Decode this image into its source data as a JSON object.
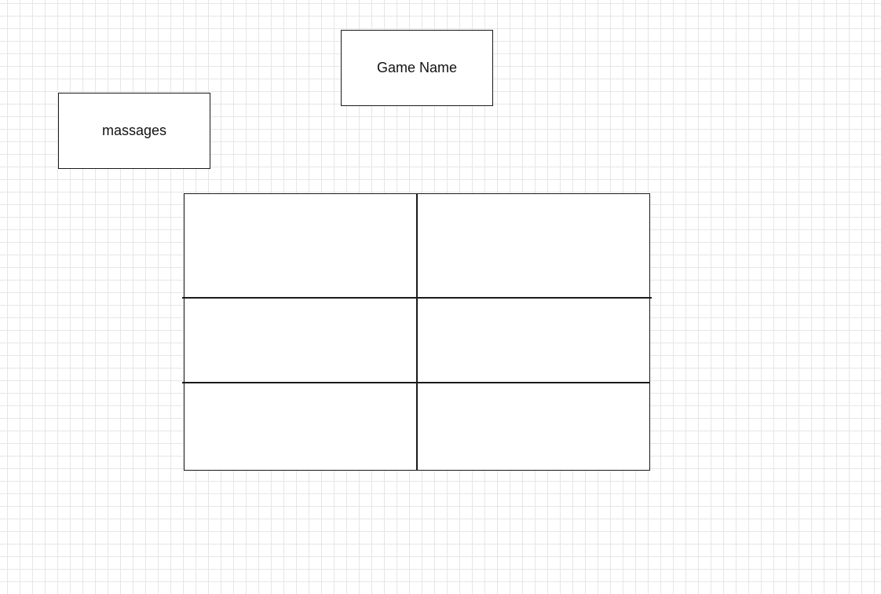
{
  "diagram": {
    "title_box": {
      "label": "Game Name"
    },
    "messages_box": {
      "label": "massages"
    },
    "board": {
      "rows": 3,
      "columns": 2,
      "cells": [
        "",
        "",
        "",
        "",
        "",
        ""
      ]
    }
  },
  "colors": {
    "background": "#ffffff",
    "grid_lines": "#e6e6e6",
    "stroke": "#1a1a1a",
    "text": "#111111"
  }
}
